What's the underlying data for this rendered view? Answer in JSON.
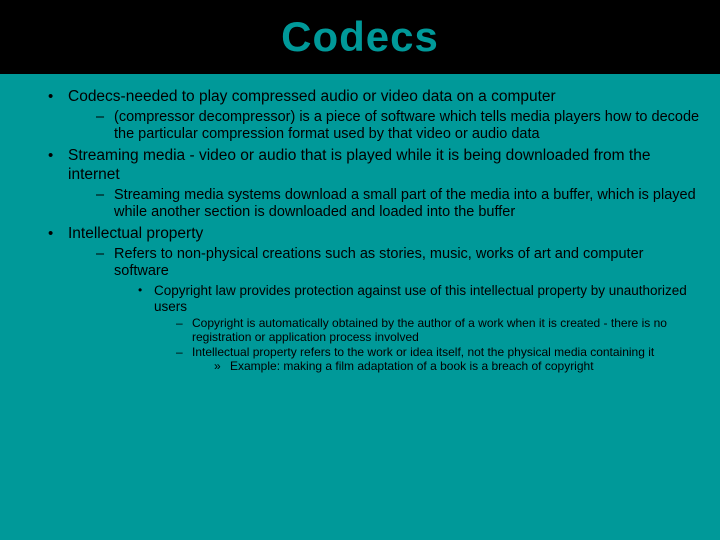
{
  "title": "Codecs",
  "bullets": [
    {
      "text": "Codecs-needed to play compressed audio or video data on a computer",
      "sub": [
        {
          "text": "(compressor decompressor) is a piece of software which tells media players how to decode the particular compression format used by that video or audio data"
        }
      ]
    },
    {
      "text": "Streaming media - video or audio that is played while it is being downloaded from the internet",
      "sub": [
        {
          "text": "Streaming media systems download a small part of the media into a buffer, which is played while another section is downloaded and loaded into the buffer"
        }
      ]
    },
    {
      "text": "Intellectual property",
      "sub": [
        {
          "text": "Refers to non-physical creations such as stories, music, works of art and computer software",
          "sub": [
            {
              "text": "Copyright law provides protection against use of this intellectual property by unauthorized users",
              "sub": [
                {
                  "text": "Copyright is automatically obtained by the author of a work when it is created - there is no registration or application process involved"
                },
                {
                  "text": "Intellectual property refers to the work or idea itself, not the physical media containing it",
                  "sub": [
                    {
                      "text": "Example:  making a film adaptation of a book is a breach of copyright"
                    }
                  ]
                }
              ]
            }
          ]
        }
      ]
    }
  ]
}
